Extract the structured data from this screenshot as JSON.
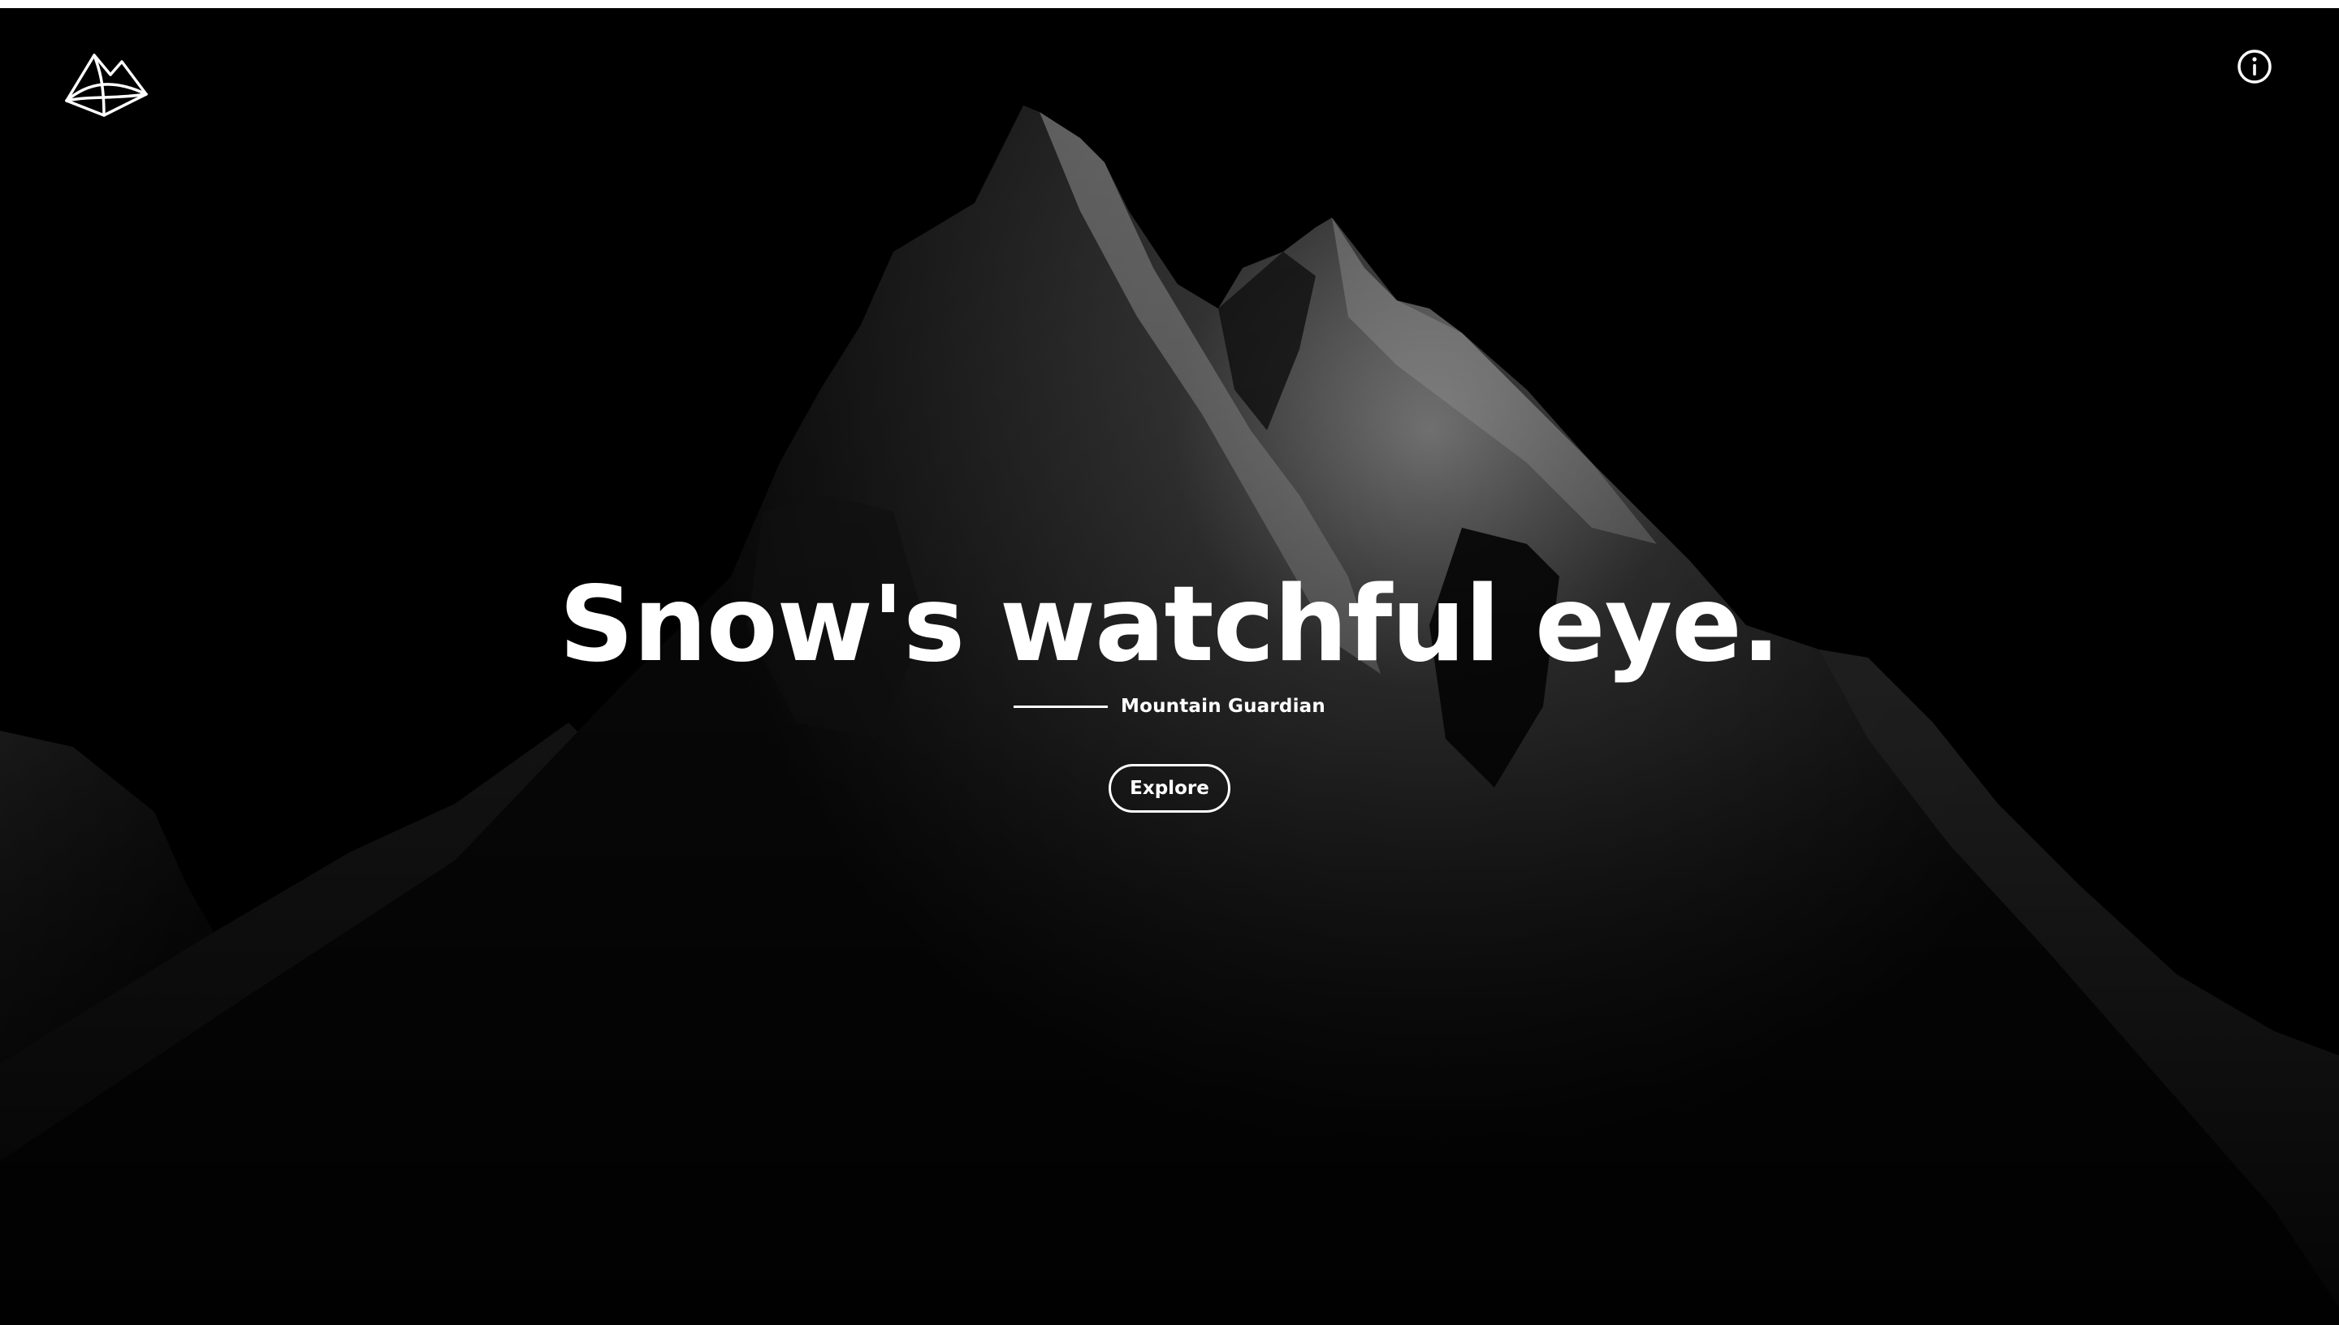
{
  "hero": {
    "headline": "Snow's watchful eye.",
    "subtitle": "Mountain Guardian",
    "cta_label": "Explore"
  },
  "icons": {
    "logo": "mountain-logo-icon",
    "info": "info-icon"
  },
  "colors": {
    "background": "#000000",
    "text": "#ffffff"
  }
}
